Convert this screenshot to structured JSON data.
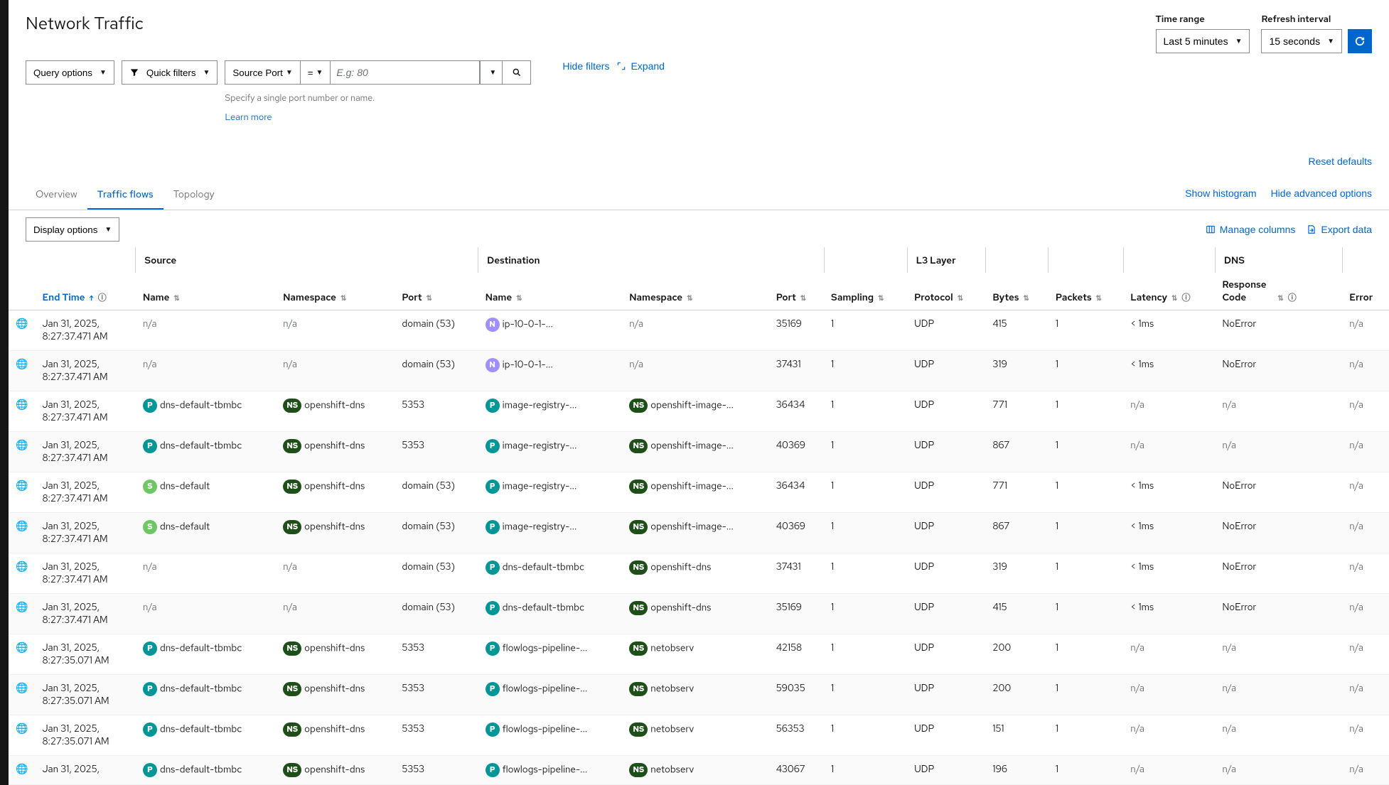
{
  "page_title": "Network Traffic",
  "time_range": {
    "label": "Time range",
    "value": "Last 5 minutes"
  },
  "refresh_interval": {
    "label": "Refresh interval",
    "value": "15 seconds"
  },
  "query_options_label": "Query options",
  "quick_filters_label": "Quick filters",
  "filter_field": {
    "label": "Source Port",
    "op": "=",
    "placeholder": "E.g: 80"
  },
  "helper_text": "Specify a single port number or name.",
  "helper_link": "Learn more",
  "hide_filters": "Hide filters",
  "expand": "Expand",
  "reset_defaults": "Reset defaults",
  "tabs": {
    "overview": "Overview",
    "traffic_flows": "Traffic flows",
    "topology": "Topology"
  },
  "tabs_links": {
    "show_histogram": "Show histogram",
    "hide_advanced": "Hide advanced options"
  },
  "display_options": "Display options",
  "toolbar_links": {
    "manage_columns": "Manage columns",
    "export_data": "Export data"
  },
  "columns": {
    "end_time": "End Time",
    "source": "Source",
    "name": "Name",
    "namespace": "Namespace",
    "port": "Port",
    "destination": "Destination",
    "sampling": "Sampling",
    "l3": "L3 Layer",
    "protocol": "Protocol",
    "bytes": "Bytes",
    "packets": "Packets",
    "latency": "Latency",
    "dns": "DNS",
    "response_code": "Response Code",
    "error": "Error"
  },
  "rows": [
    {
      "end_date": "Jan 31, 2025,",
      "end_time": "8:27:37.471 AM",
      "src_name": "n/a",
      "src_ns": "n/a",
      "src_port": "domain (53)",
      "dst_name": "ip-10-0-1-...",
      "dst_name_badge": "N",
      "dst_ns": "n/a",
      "dst_port": "35169",
      "sampling": "1",
      "protocol": "UDP",
      "bytes": "415",
      "packets": "1",
      "latency": "< 1ms",
      "resp": "NoError",
      "error": "n/a"
    },
    {
      "end_date": "Jan 31, 2025,",
      "end_time": "8:27:37.471 AM",
      "src_name": "n/a",
      "src_ns": "n/a",
      "src_port": "domain (53)",
      "dst_name": "ip-10-0-1-...",
      "dst_name_badge": "N",
      "dst_ns": "n/a",
      "dst_port": "37431",
      "sampling": "1",
      "protocol": "UDP",
      "bytes": "319",
      "packets": "1",
      "latency": "< 1ms",
      "resp": "NoError",
      "error": "n/a"
    },
    {
      "end_date": "Jan 31, 2025,",
      "end_time": "8:27:37.471 AM",
      "src_name": "dns-default-tbmbc",
      "src_name_badge": "P",
      "src_ns": "openshift-dns",
      "src_ns_badge": "NS",
      "src_port": "5353",
      "dst_name": "image-registry-...",
      "dst_name_badge": "P",
      "dst_ns": "openshift-image-...",
      "dst_ns_badge": "NS",
      "dst_port": "36434",
      "sampling": "1",
      "protocol": "UDP",
      "bytes": "771",
      "packets": "1",
      "latency": "n/a",
      "resp": "n/a",
      "error": "n/a"
    },
    {
      "end_date": "Jan 31, 2025,",
      "end_time": "8:27:37.471 AM",
      "src_name": "dns-default-tbmbc",
      "src_name_badge": "P",
      "src_ns": "openshift-dns",
      "src_ns_badge": "NS",
      "src_port": "5353",
      "dst_name": "image-registry-...",
      "dst_name_badge": "P",
      "dst_ns": "openshift-image-...",
      "dst_ns_badge": "NS",
      "dst_port": "40369",
      "sampling": "1",
      "protocol": "UDP",
      "bytes": "867",
      "packets": "1",
      "latency": "n/a",
      "resp": "n/a",
      "error": "n/a"
    },
    {
      "end_date": "Jan 31, 2025,",
      "end_time": "8:27:37.471 AM",
      "src_name": "dns-default",
      "src_name_badge": "S",
      "src_ns": "openshift-dns",
      "src_ns_badge": "NS",
      "src_port": "domain (53)",
      "dst_name": "image-registry-...",
      "dst_name_badge": "P",
      "dst_ns": "openshift-image-...",
      "dst_ns_badge": "NS",
      "dst_port": "36434",
      "sampling": "1",
      "protocol": "UDP",
      "bytes": "771",
      "packets": "1",
      "latency": "< 1ms",
      "resp": "NoError",
      "error": "n/a"
    },
    {
      "end_date": "Jan 31, 2025,",
      "end_time": "8:27:37.471 AM",
      "src_name": "dns-default",
      "src_name_badge": "S",
      "src_ns": "openshift-dns",
      "src_ns_badge": "NS",
      "src_port": "domain (53)",
      "dst_name": "image-registry-...",
      "dst_name_badge": "P",
      "dst_ns": "openshift-image-...",
      "dst_ns_badge": "NS",
      "dst_port": "40369",
      "sampling": "1",
      "protocol": "UDP",
      "bytes": "867",
      "packets": "1",
      "latency": "< 1ms",
      "resp": "NoError",
      "error": "n/a"
    },
    {
      "end_date": "Jan 31, 2025,",
      "end_time": "8:27:37.471 AM",
      "src_name": "n/a",
      "src_ns": "n/a",
      "src_port": "domain (53)",
      "dst_name": "dns-default-tbmbc",
      "dst_name_badge": "P",
      "dst_ns": "openshift-dns",
      "dst_ns_badge": "NS",
      "dst_port": "37431",
      "sampling": "1",
      "protocol": "UDP",
      "bytes": "319",
      "packets": "1",
      "latency": "< 1ms",
      "resp": "NoError",
      "error": "n/a"
    },
    {
      "end_date": "Jan 31, 2025,",
      "end_time": "8:27:37.471 AM",
      "src_name": "n/a",
      "src_ns": "n/a",
      "src_port": "domain (53)",
      "dst_name": "dns-default-tbmbc",
      "dst_name_badge": "P",
      "dst_ns": "openshift-dns",
      "dst_ns_badge": "NS",
      "dst_port": "35169",
      "sampling": "1",
      "protocol": "UDP",
      "bytes": "415",
      "packets": "1",
      "latency": "< 1ms",
      "resp": "NoError",
      "error": "n/a"
    },
    {
      "end_date": "Jan 31, 2025,",
      "end_time": "8:27:35.071 AM",
      "src_name": "dns-default-tbmbc",
      "src_name_badge": "P",
      "src_ns": "openshift-dns",
      "src_ns_badge": "NS",
      "src_port": "5353",
      "dst_name": "flowlogs-pipeline-...",
      "dst_name_badge": "P",
      "dst_ns": "netobserv",
      "dst_ns_badge": "NS",
      "dst_port": "42158",
      "sampling": "1",
      "protocol": "UDP",
      "bytes": "200",
      "packets": "1",
      "latency": "n/a",
      "resp": "n/a",
      "error": "n/a"
    },
    {
      "end_date": "Jan 31, 2025,",
      "end_time": "8:27:35.071 AM",
      "src_name": "dns-default-tbmbc",
      "src_name_badge": "P",
      "src_ns": "openshift-dns",
      "src_ns_badge": "NS",
      "src_port": "5353",
      "dst_name": "flowlogs-pipeline-...",
      "dst_name_badge": "P",
      "dst_ns": "netobserv",
      "dst_ns_badge": "NS",
      "dst_port": "59035",
      "sampling": "1",
      "protocol": "UDP",
      "bytes": "200",
      "packets": "1",
      "latency": "n/a",
      "resp": "n/a",
      "error": "n/a"
    },
    {
      "end_date": "Jan 31, 2025,",
      "end_time": "8:27:35.071 AM",
      "src_name": "dns-default-tbmbc",
      "src_name_badge": "P",
      "src_ns": "openshift-dns",
      "src_ns_badge": "NS",
      "src_port": "5353",
      "dst_name": "flowlogs-pipeline-...",
      "dst_name_badge": "P",
      "dst_ns": "netobserv",
      "dst_ns_badge": "NS",
      "dst_port": "56353",
      "sampling": "1",
      "protocol": "UDP",
      "bytes": "151",
      "packets": "1",
      "latency": "n/a",
      "resp": "n/a",
      "error": "n/a"
    },
    {
      "end_date": "Jan 31, 2025,",
      "end_time": "",
      "src_name": "dns-default-tbmbc",
      "src_name_badge": "P",
      "src_ns": "openshift-dns",
      "src_ns_badge": "NS",
      "src_port": "5353",
      "dst_name": "flowlogs-pipeline-...",
      "dst_name_badge": "P",
      "dst_ns": "netobserv",
      "dst_ns_badge": "NS",
      "dst_port": "43067",
      "sampling": "1",
      "protocol": "UDP",
      "bytes": "196",
      "packets": "1",
      "latency": "n/a",
      "resp": "n/a",
      "error": "n/a"
    }
  ]
}
